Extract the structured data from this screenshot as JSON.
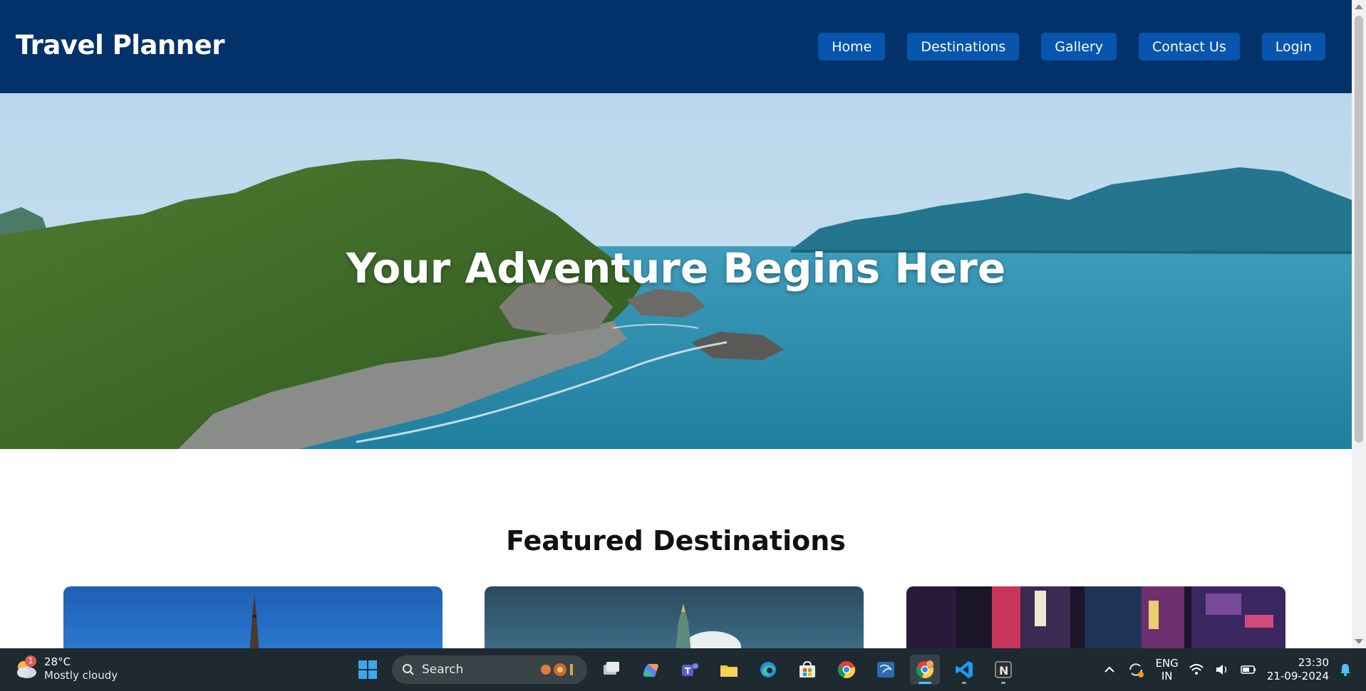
{
  "header": {
    "brand": "Travel Planner",
    "nav": [
      "Home",
      "Destinations",
      "Gallery",
      "Contact Us",
      "Login"
    ]
  },
  "hero": {
    "title": "Your Adventure Begins Here"
  },
  "featured": {
    "title": "Featured Destinations"
  },
  "colors": {
    "header_bg": "#03326a",
    "nav_button": "#0755ad",
    "taskbar": "#1f2a30"
  },
  "taskbar": {
    "weather": {
      "temp": "28°C",
      "desc": "Mostly cloudy",
      "badge": "1"
    },
    "search_label": "Search",
    "apps": [
      "task-view-icon",
      "copilot-icon",
      "teams-icon",
      "file-explorer-icon",
      "edge-icon",
      "store-icon",
      "chrome-icon",
      "remote-desktop-icon",
      "chrome-active-icon",
      "vscode-icon",
      "notion-icon"
    ],
    "lang": {
      "line1": "ENG",
      "line2": "IN"
    },
    "clock": {
      "time": "23:30",
      "date": "21-09-2024"
    }
  }
}
